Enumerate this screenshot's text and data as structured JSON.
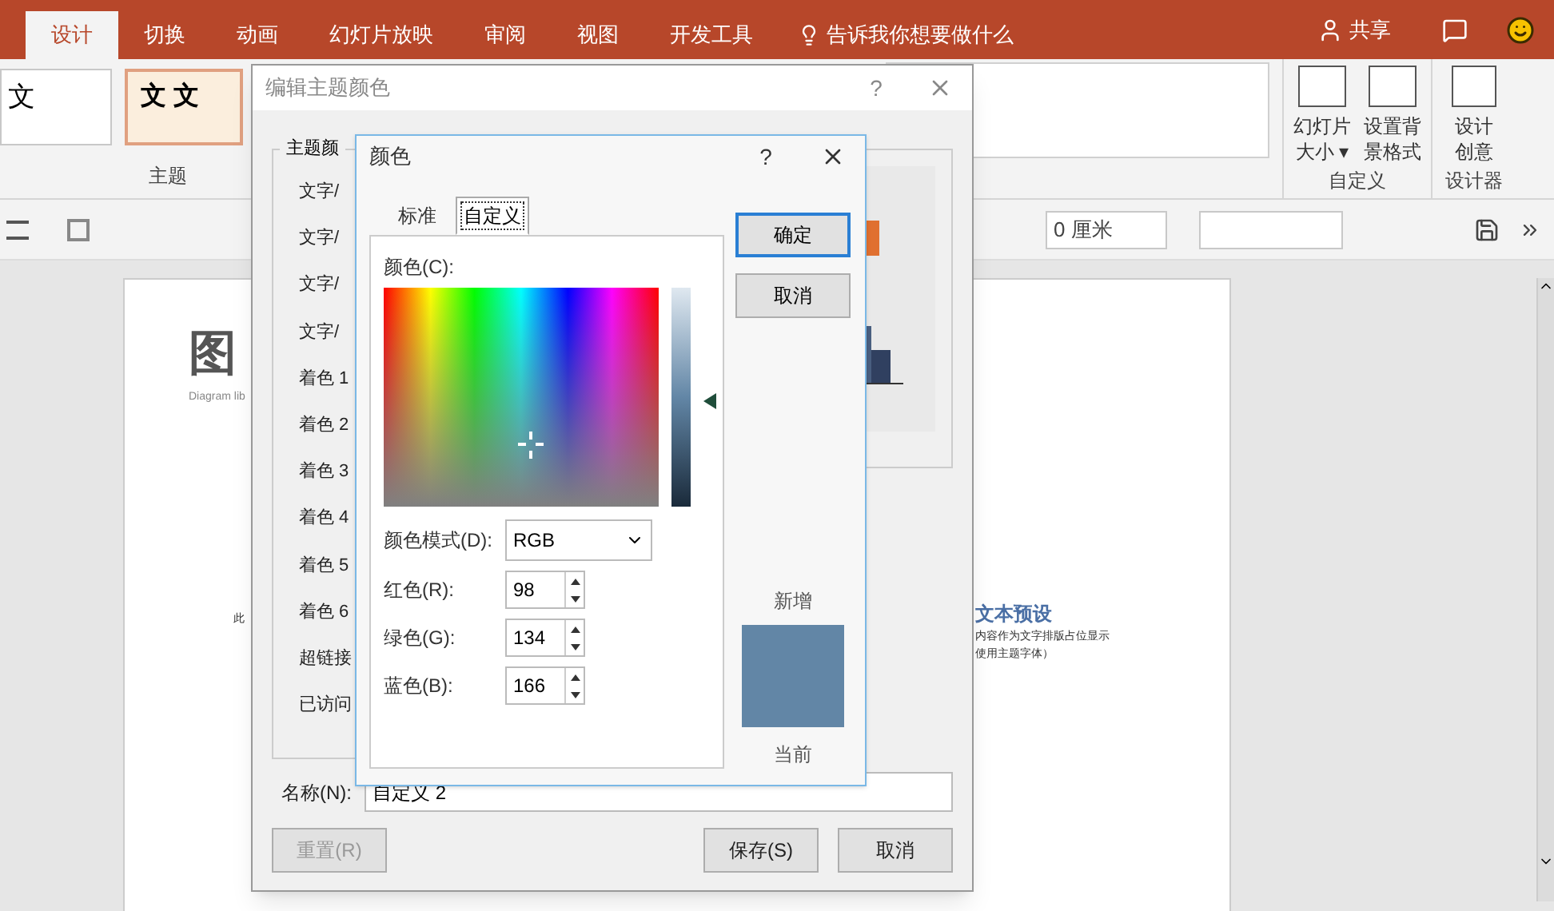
{
  "ribbon_tabs": [
    {
      "label": "设计",
      "selected": true
    },
    {
      "label": "切换",
      "selected": false
    },
    {
      "label": "动画",
      "selected": false
    },
    {
      "label": "幻灯片放映",
      "selected": false
    },
    {
      "label": "审阅",
      "selected": false
    },
    {
      "label": "视图",
      "selected": false
    },
    {
      "label": "开发工具",
      "selected": false
    }
  ],
  "tell_me": "告诉我你想要做什么",
  "share": "共享",
  "themes": {
    "thumbnails": [
      "文",
      "文 文"
    ],
    "group_label": "主题"
  },
  "customize": {
    "buttons": [
      [
        "幻灯片",
        "大小 ▾"
      ],
      [
        "设置背",
        "景格式"
      ]
    ],
    "group_label": "自定义"
  },
  "designer": {
    "button": [
      "设计",
      "创意"
    ],
    "group_label": "设计器"
  },
  "toolbar": {
    "spacing_field": "0 厘米"
  },
  "slide": {
    "title": "图",
    "subtitle": "Diagram lib",
    "left_note": "此",
    "heading": "文本预设",
    "lines": [
      "内容作为文字排版占位显示",
      "使用主题字体）"
    ]
  },
  "theme_dialog": {
    "title": "编辑主题颜色",
    "help": "?",
    "group_label": "主题颜",
    "rows": [
      "文字/",
      "文字/",
      "文字/",
      "文字/",
      "着色 1",
      "着色 2",
      "着色 3",
      "着色 4",
      "着色 5",
      "着色 6",
      "超链接",
      "已访问"
    ],
    "name_label": "名称(N):",
    "name_value": "自定义 2",
    "buttons": [
      {
        "label": "重置(R)",
        "disabled": true
      },
      {
        "label": "保存(S)",
        "disabled": false
      },
      {
        "label": "取消",
        "disabled": false
      }
    ]
  },
  "color_dialog": {
    "title": "颜色",
    "help": "?",
    "tabs": [
      {
        "label": "标准",
        "selected": false
      },
      {
        "label": "自定义",
        "selected": true
      }
    ],
    "colors_label": "颜色(C):",
    "mode_label": "颜色模式(D):",
    "mode_value": "RGB",
    "channels": [
      {
        "label": "红色(R):",
        "value": "98"
      },
      {
        "label": "绿色(G):",
        "value": "134"
      },
      {
        "label": "蓝色(B):",
        "value": "166"
      }
    ],
    "buttons": [
      {
        "label": "确定",
        "default": true
      },
      {
        "label": "取消",
        "default": false
      }
    ],
    "new_label": "新增",
    "current_label": "当前"
  }
}
